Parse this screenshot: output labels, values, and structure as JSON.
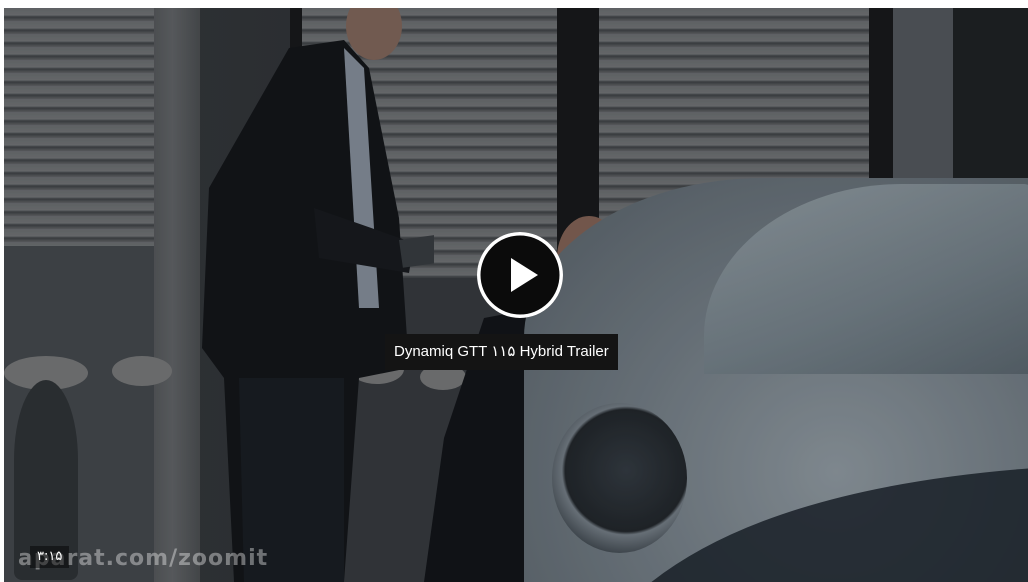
{
  "video": {
    "title": "Dynamiq GTT ۱۱۵ Hybrid Trailer",
    "duration": "۳:۱۵",
    "watermark": "aparat.com/zoomit"
  },
  "icons": {
    "play": "play-icon"
  },
  "colors": {
    "overlay_bg": "#141414",
    "overlay_text": "#ffffff",
    "play_button_bg": "#0b0b0b"
  }
}
